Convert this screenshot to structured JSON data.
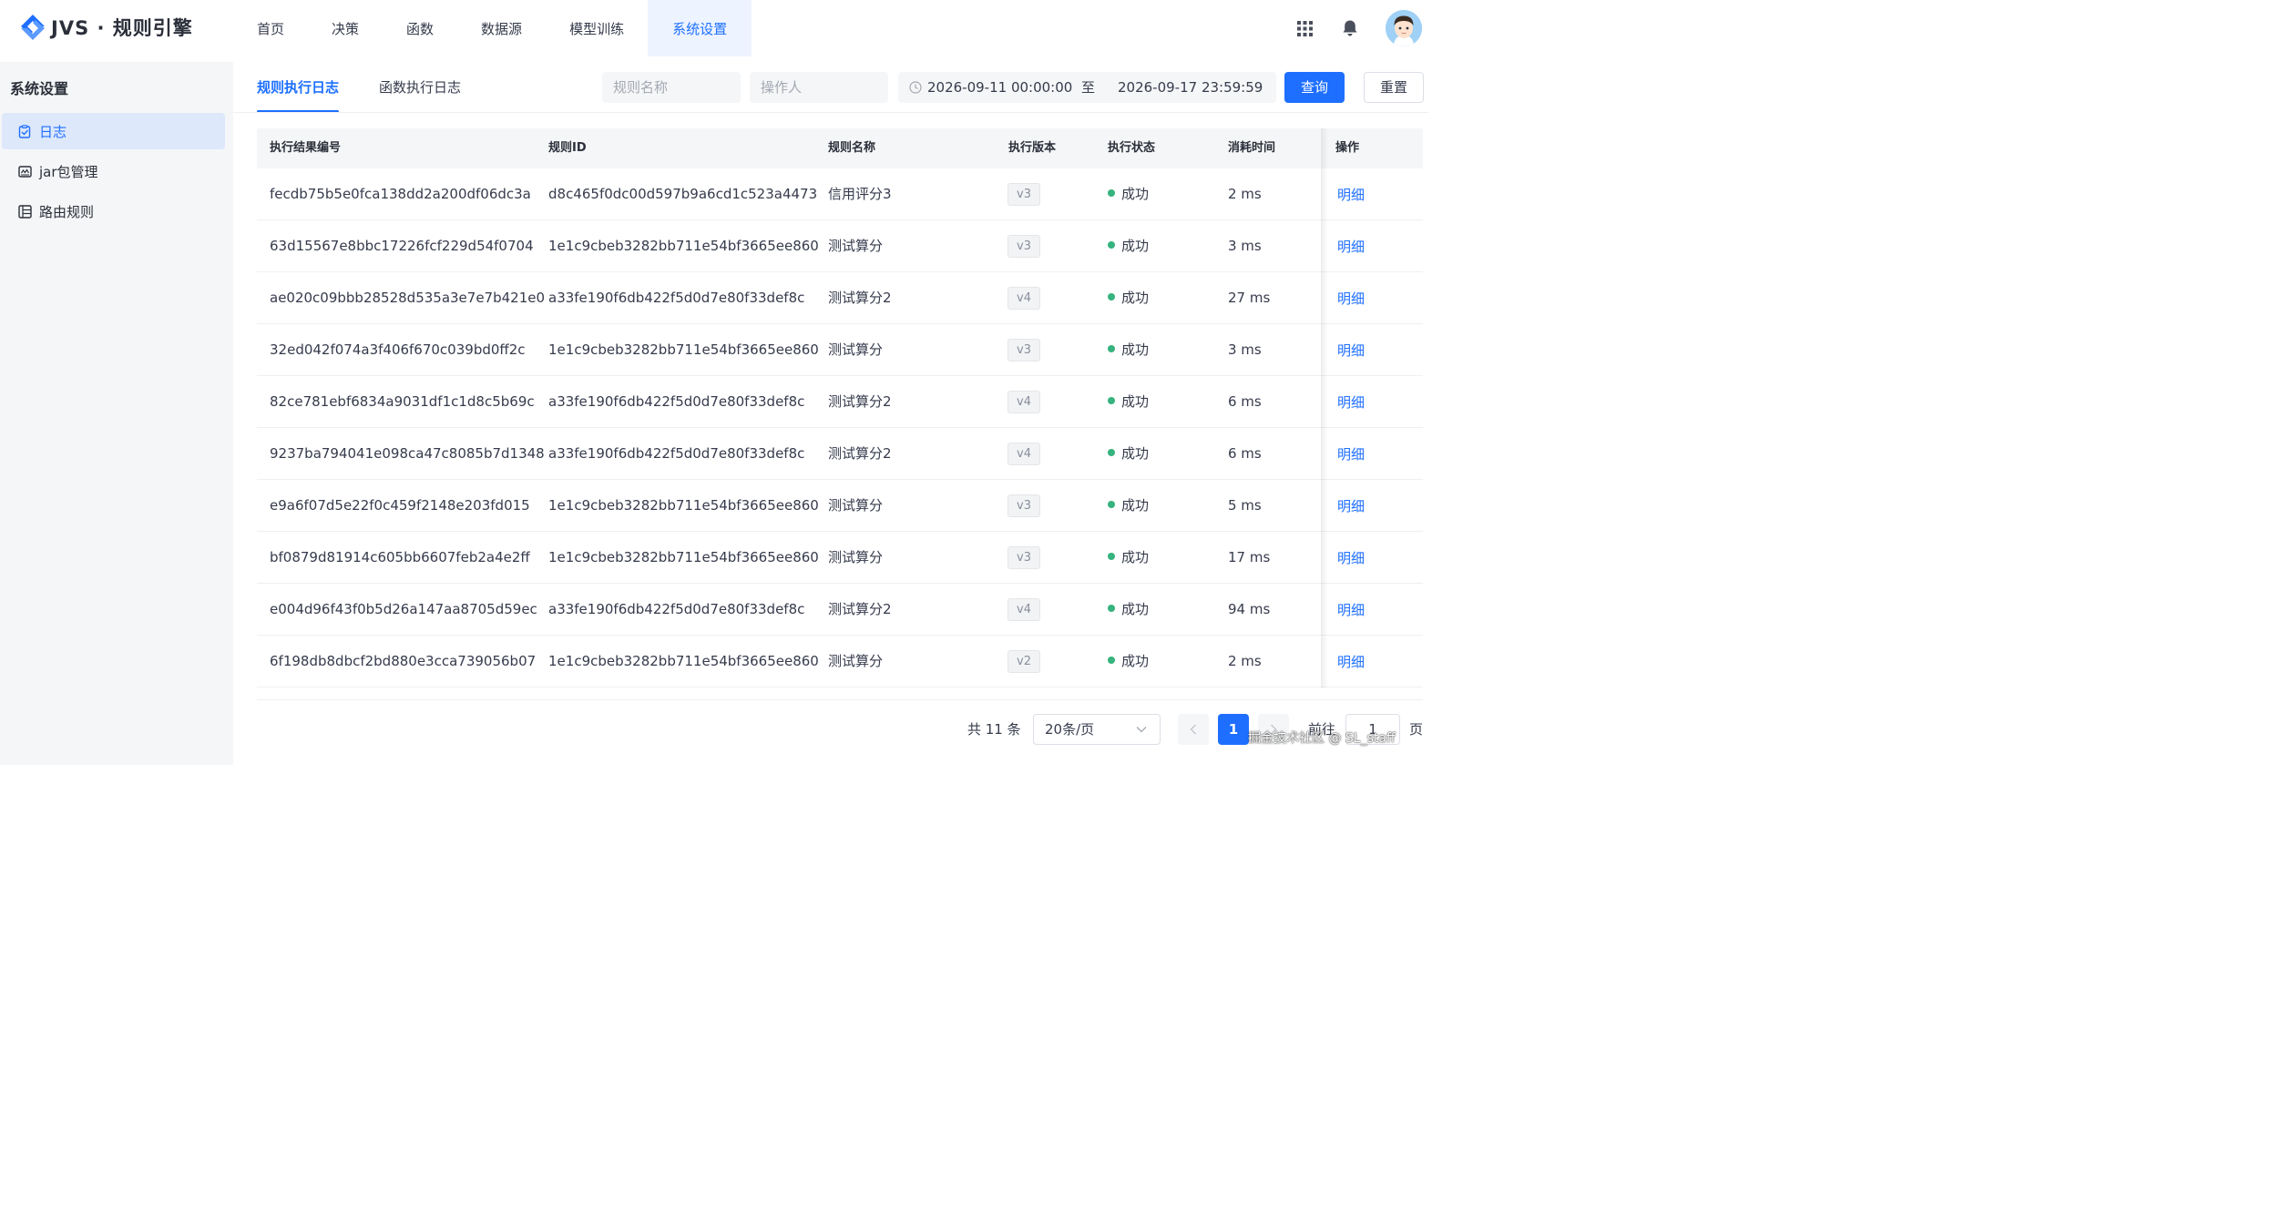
{
  "app": {
    "logo_text": "JVS · 规则引擎"
  },
  "nav": {
    "items": [
      {
        "label": "首页"
      },
      {
        "label": "决策"
      },
      {
        "label": "函数"
      },
      {
        "label": "数据源"
      },
      {
        "label": "模型训练"
      },
      {
        "label": "系统设置",
        "active": true
      }
    ]
  },
  "sidebar": {
    "title": "系统设置",
    "items": [
      {
        "label": "日志",
        "icon": "log-icon",
        "active": true
      },
      {
        "label": "jar包管理",
        "icon": "jar-icon"
      },
      {
        "label": "路由规则",
        "icon": "route-icon"
      }
    ]
  },
  "tabs": [
    {
      "label": "规则执行日志",
      "active": true
    },
    {
      "label": "函数执行日志"
    }
  ],
  "filters": {
    "rule_name_placeholder": "规则名称",
    "operator_placeholder": "操作人",
    "date_start": "2026-09-11 00:00:00",
    "date_sep": "至",
    "date_end": "2026-09-17 23:59:59",
    "query_label": "查询",
    "reset_label": "重置"
  },
  "table": {
    "columns": [
      "执行结果编号",
      "规则ID",
      "规则名称",
      "执行版本",
      "执行状态",
      "消耗时间",
      "操作"
    ],
    "rows": [
      {
        "id": "fecdb75b5e0fca138dd2a200df06dc3a",
        "rule_id": "d8c465f0dc00d597b9a6cd1c523a4473",
        "name": "信用评分3",
        "version": "v3",
        "status": "成功",
        "cost": "2 ms",
        "action": "明细"
      },
      {
        "id": "63d15567e8bbc17226fcf229d54f0704",
        "rule_id": "1e1c9cbeb3282bb711e54bf3665ee860",
        "name": "测试算分",
        "version": "v3",
        "status": "成功",
        "cost": "3 ms",
        "action": "明细"
      },
      {
        "id": "ae020c09bbb28528d535a3e7e7b421e0",
        "rule_id": "a33fe190f6db422f5d0d7e80f33def8c",
        "name": "测试算分2",
        "version": "v4",
        "status": "成功",
        "cost": "27 ms",
        "action": "明细"
      },
      {
        "id": "32ed042f074a3f406f670c039bd0ff2c",
        "rule_id": "1e1c9cbeb3282bb711e54bf3665ee860",
        "name": "测试算分",
        "version": "v3",
        "status": "成功",
        "cost": "3 ms",
        "action": "明细"
      },
      {
        "id": "82ce781ebf6834a9031df1c1d8c5b69c",
        "rule_id": "a33fe190f6db422f5d0d7e80f33def8c",
        "name": "测试算分2",
        "version": "v4",
        "status": "成功",
        "cost": "6 ms",
        "action": "明细"
      },
      {
        "id": "9237ba794041e098ca47c8085b7d1348",
        "rule_id": "a33fe190f6db422f5d0d7e80f33def8c",
        "name": "测试算分2",
        "version": "v4",
        "status": "成功",
        "cost": "6 ms",
        "action": "明细"
      },
      {
        "id": "e9a6f07d5e22f0c459f2148e203fd015",
        "rule_id": "1e1c9cbeb3282bb711e54bf3665ee860",
        "name": "测试算分",
        "version": "v3",
        "status": "成功",
        "cost": "5 ms",
        "action": "明细"
      },
      {
        "id": "bf0879d81914c605bb6607feb2a4e2ff",
        "rule_id": "1e1c9cbeb3282bb711e54bf3665ee860",
        "name": "测试算分",
        "version": "v3",
        "status": "成功",
        "cost": "17 ms",
        "action": "明细"
      },
      {
        "id": "e004d96f43f0b5d26a147aa8705d59ec",
        "rule_id": "a33fe190f6db422f5d0d7e80f33def8c",
        "name": "测试算分2",
        "version": "v4",
        "status": "成功",
        "cost": "94 ms",
        "action": "明细"
      },
      {
        "id": "6f198db8dbcf2bd880e3cca739056b07",
        "rule_id": "1e1c9cbeb3282bb711e54bf3665ee860",
        "name": "测试算分",
        "version": "v2",
        "status": "成功",
        "cost": "2 ms",
        "action": "明细"
      }
    ]
  },
  "pagination": {
    "total": "共 11 条",
    "page_size": "20条/页",
    "current": "1",
    "goto_label": "前往",
    "goto_value": "1",
    "page_unit": "页"
  },
  "watermark": "掘金技术社区 @ SL_staff",
  "colors": {
    "primary": "#1e6fff",
    "success": "#36b37e",
    "sidebar_bg": "#f5f6f7"
  }
}
